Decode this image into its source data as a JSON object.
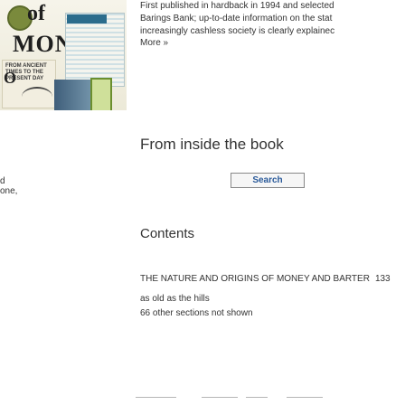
{
  "cover": {
    "title_of": "of",
    "title_money": "MONEY",
    "mini_heading": "FROM ANCIENT TIMES TO THE PRESENT DAY",
    "mini_letter": "O"
  },
  "blurb": {
    "line1": "First published in hardback in 1994 and selected",
    "line2": "Barings Bank; up-to-date information on the stat",
    "line3": "increasingly cashless society is clearly explainec",
    "more_label": "More »"
  },
  "inside": {
    "heading": "From inside the book",
    "search_label": "Search",
    "left_fragment_1": "d",
    "left_fragment_2": "one,"
  },
  "contents": {
    "heading": "Contents",
    "items": [
      {
        "title": "THE NATURE AND ORIGINS OF MONEY AND BARTER",
        "page": "133"
      }
    ],
    "sub_entry": "as old as the hills",
    "other_sections": "66 other sections not shown"
  }
}
